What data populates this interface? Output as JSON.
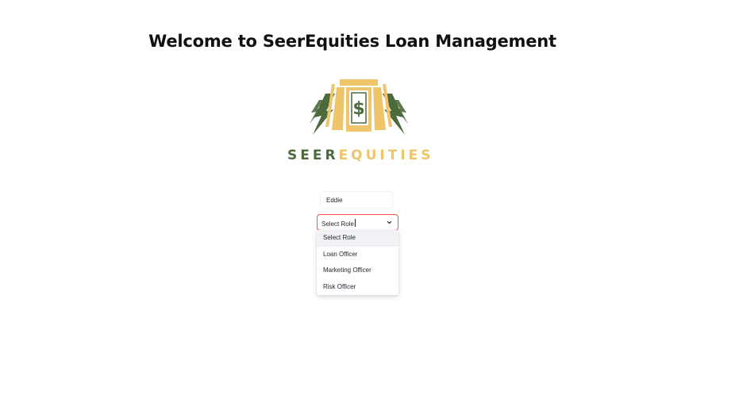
{
  "page": {
    "title": "Welcome to SeerEquities Loan Management"
  },
  "logo": {
    "word_left": "SEER",
    "word_right": "EQUITIES",
    "symbol": "$",
    "colors": {
      "green": "#4d6a3c",
      "gold": "#efc56b"
    }
  },
  "form": {
    "name_value": "Eddie",
    "role_select": {
      "selected": "Select Role",
      "options": [
        "Select Role",
        "Loan Officer",
        "Marketing Officer",
        "Risk Officer"
      ],
      "highlighted_index": 0,
      "accent": "#ff4b4b"
    }
  }
}
